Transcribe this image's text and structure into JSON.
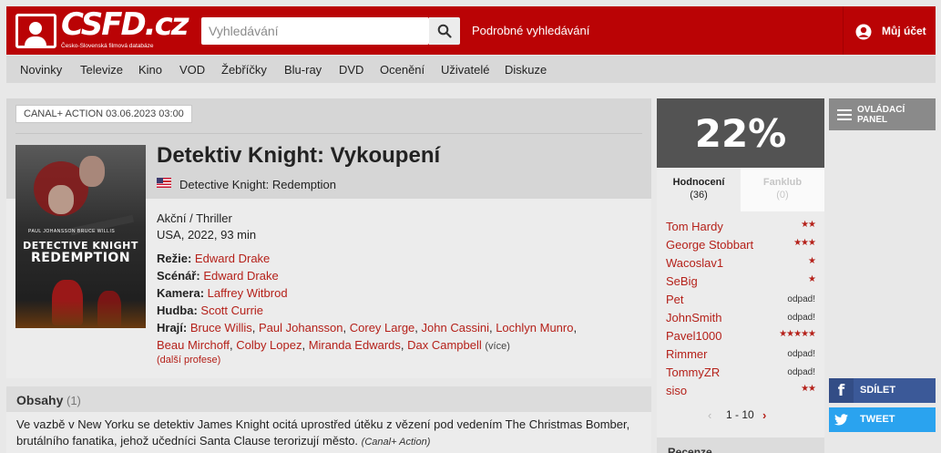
{
  "header": {
    "logo_text": "CSFD.cz",
    "logo_subtitle": "Česko-Slovenská filmová databáze",
    "search_placeholder": "Vyhledávání",
    "advanced_search": "Podrobné vyhledávání",
    "account": "Můj účet"
  },
  "nav": {
    "items": [
      "Novinky",
      "Televize",
      "Kino",
      "VOD",
      "Žebříčky",
      "Blu-ray",
      "DVD",
      "Ocenění",
      "Uživatelé",
      "Diskuze"
    ]
  },
  "film": {
    "tv_badge": "CANAL+ ACTION 03.06.2023 03:00",
    "title": "Detektiv Knight: Vykoupení",
    "original_title": "Detective Knight: Redemption",
    "genres": "Akční / Thriller",
    "origin": "USA, 2022, 93 min",
    "poster": {
      "names": "PAUL JOHANSSON   BRUCE WILLIS",
      "title_line1": "DETECTIVE KNIGHT",
      "title_line2": "REDEMPTION"
    },
    "crew": {
      "director_label": "Režie:",
      "director": "Edward Drake",
      "writer_label": "Scénář:",
      "writer": "Edward Drake",
      "camera_label": "Kamera:",
      "camera": "Laffrey Witbrod",
      "music_label": "Hudba:",
      "music": "Scott Currie",
      "actors_label": "Hrají:",
      "actors": [
        "Bruce Willis",
        "Paul Johansson",
        "Corey Large",
        "John Cassini",
        "Lochlyn Munro",
        "Beau Mirchoff",
        "Colby Lopez",
        "Miranda Edwards",
        "Dax Campbell"
      ],
      "actors_more": "(více)",
      "more_crew": "(další profese)"
    }
  },
  "synopsis": {
    "title": "Obsahy",
    "count": "(1)",
    "text": "Ve vazbě v New Yorku se detektiv James Knight ocitá uprostřed útěku z vězení pod vedením The Christmas Bomber, brutálního fanatika, jehož učedníci Santa Clause terorizují město.",
    "source": "(Canal+ Action)"
  },
  "rating": {
    "value": "22%",
    "tabs": [
      {
        "label": "Hodnocení",
        "count": "(36)"
      },
      {
        "label": "Fanklub",
        "count": "(0)"
      }
    ],
    "users": [
      {
        "name": "Tom Hardy",
        "stars": "★★",
        "waste": ""
      },
      {
        "name": "George Stobbart",
        "stars": "★★★",
        "waste": ""
      },
      {
        "name": "Wacoslav1",
        "stars": "★",
        "waste": ""
      },
      {
        "name": "SeBig",
        "stars": "★",
        "waste": ""
      },
      {
        "name": "Pet",
        "stars": "",
        "waste": "odpad!"
      },
      {
        "name": "JohnSmith",
        "stars": "",
        "waste": "odpad!"
      },
      {
        "name": "Pavel1000",
        "stars": "★★★★★",
        "waste": ""
      },
      {
        "name": "Rimmer",
        "stars": "",
        "waste": "odpad!"
      },
      {
        "name": "TommyZR",
        "stars": "",
        "waste": "odpad!"
      },
      {
        "name": "siso",
        "stars": "★★",
        "waste": ""
      }
    ],
    "pager": {
      "prev": "‹",
      "range": "1 - 10",
      "next": "›"
    },
    "next_section": "Recenze"
  },
  "side": {
    "control_panel": "OVLÁDACÍ PANEL",
    "share_fb": "SDÍLET",
    "share_tw": "TWEET"
  },
  "colors": {
    "brand_red": "#ba0305",
    "link_red": "#b5211a",
    "rating_box": "#535353",
    "facebook": "#3b5998",
    "twitter": "#2aa3ef"
  },
  "icons": {
    "search": "search-icon",
    "account": "user-icon",
    "flag": "us-flag-icon",
    "menu": "menu-icon",
    "facebook": "facebook-icon",
    "twitter": "twitter-icon"
  }
}
